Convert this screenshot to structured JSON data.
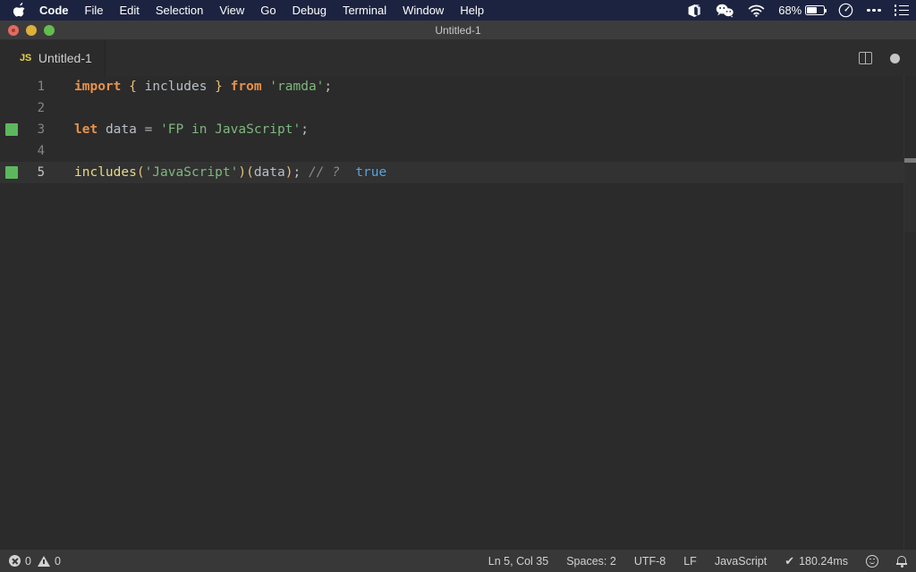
{
  "menubar": {
    "apple_glyph": "",
    "items": [
      {
        "label": "Code",
        "bold": true
      },
      {
        "label": "File",
        "bold": false
      },
      {
        "label": "Edit",
        "bold": false
      },
      {
        "label": "Selection",
        "bold": false
      },
      {
        "label": "View",
        "bold": false
      },
      {
        "label": "Go",
        "bold": false
      },
      {
        "label": "Debug",
        "bold": false
      },
      {
        "label": "Terminal",
        "bold": false
      },
      {
        "label": "Window",
        "bold": false
      },
      {
        "label": "Help",
        "bold": false
      }
    ],
    "status_icons": [
      "box-icon",
      "wechat-icon",
      "wifi-icon",
      "battery-icon",
      "clock-icon",
      "control-center-icon",
      "list-icon"
    ],
    "battery_percent": "68%",
    "background": "#1c2340"
  },
  "window": {
    "title": "Untitled-1",
    "controls": [
      "close-button",
      "minimize-button",
      "zoom-button"
    ]
  },
  "tabbar": {
    "tabs": [
      {
        "label": "Untitled-1",
        "icon": "JS",
        "icon_color": "#e8d44d",
        "active": true,
        "dirty": true
      }
    ],
    "actions": [
      "split-editor-icon",
      "unsaved-indicator"
    ]
  },
  "editor": {
    "language": "JavaScript",
    "lines": [
      {
        "number": "1",
        "marker": false,
        "current": false,
        "tokens": [
          {
            "text": "import",
            "cls": "t-kw"
          },
          {
            "text": " ",
            "cls": "t-punc"
          },
          {
            "text": "{",
            "cls": "t-brace"
          },
          {
            "text": " ",
            "cls": "t-punc"
          },
          {
            "text": "includes",
            "cls": "t-id"
          },
          {
            "text": " ",
            "cls": "t-punc"
          },
          {
            "text": "}",
            "cls": "t-brace"
          },
          {
            "text": " ",
            "cls": "t-punc"
          },
          {
            "text": "from",
            "cls": "t-kw"
          },
          {
            "text": " ",
            "cls": "t-punc"
          },
          {
            "text": "'ramda'",
            "cls": "t-str"
          },
          {
            "text": ";",
            "cls": "t-punc"
          }
        ]
      },
      {
        "number": "2",
        "marker": false,
        "current": false,
        "tokens": []
      },
      {
        "number": "3",
        "marker": true,
        "current": false,
        "tokens": [
          {
            "text": "let",
            "cls": "t-kw"
          },
          {
            "text": " ",
            "cls": "t-punc"
          },
          {
            "text": "data",
            "cls": "t-var"
          },
          {
            "text": " ",
            "cls": "t-punc"
          },
          {
            "text": "=",
            "cls": "t-op"
          },
          {
            "text": " ",
            "cls": "t-punc"
          },
          {
            "text": "'FP in JavaScript'",
            "cls": "t-str"
          },
          {
            "text": ";",
            "cls": "t-punc"
          }
        ]
      },
      {
        "number": "4",
        "marker": false,
        "current": false,
        "tokens": []
      },
      {
        "number": "5",
        "marker": true,
        "current": true,
        "tokens": [
          {
            "text": "includes",
            "cls": "t-fn"
          },
          {
            "text": "(",
            "cls": "t-paren"
          },
          {
            "text": "'JavaScript'",
            "cls": "t-str"
          },
          {
            "text": ")",
            "cls": "t-paren"
          },
          {
            "text": "(",
            "cls": "t-paren"
          },
          {
            "text": "data",
            "cls": "t-var"
          },
          {
            "text": ")",
            "cls": "t-paren"
          },
          {
            "text": ";",
            "cls": "t-punc"
          },
          {
            "text": " ",
            "cls": "t-punc"
          },
          {
            "text": "// ?",
            "cls": "t-com"
          },
          {
            "text": "  ",
            "cls": "t-punc"
          },
          {
            "text": "true",
            "cls": "t-val"
          }
        ]
      }
    ],
    "plain_text": "import { includes } from 'ramda';\n\nlet data = 'FP in JavaScript';\n\nincludes('JavaScript')(data); // ?  true",
    "marker_color": "#5cb85c",
    "background": "#2b2b2b"
  },
  "statusbar": {
    "errors": "0",
    "warnings": "0",
    "cursor": "Ln 5, Col 35",
    "indentation": "Spaces: 2",
    "encoding": "UTF-8",
    "eol": "LF",
    "language": "JavaScript",
    "run_time": "180.24ms",
    "run_check": "✔",
    "right_icons": [
      "smiley-icon",
      "bell-icon"
    ],
    "background": "#383838"
  }
}
